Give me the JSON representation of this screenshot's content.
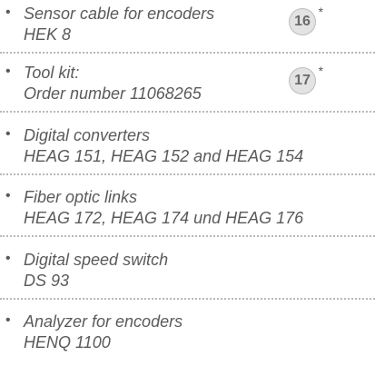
{
  "bullet_glyph": "•",
  "items": [
    {
      "line1": "Sensor cable for encoders",
      "line2": "HEK 8",
      "badge": "16",
      "note": "*"
    },
    {
      "line1": "Tool kit:",
      "line2": "Order number 11068265",
      "badge": "17",
      "note": "*"
    },
    {
      "line1": "Digital converters",
      "line2": "HEAG 151, HEAG 152 and HEAG 154"
    },
    {
      "line1": "Fiber optic links",
      "line2": "HEAG 172, HEAG 174 und HEAG 176"
    },
    {
      "line1": "Digital speed switch",
      "line2": "DS 93"
    },
    {
      "line1": "Analyzer for encoders",
      "line2": "HENQ 1100"
    }
  ]
}
